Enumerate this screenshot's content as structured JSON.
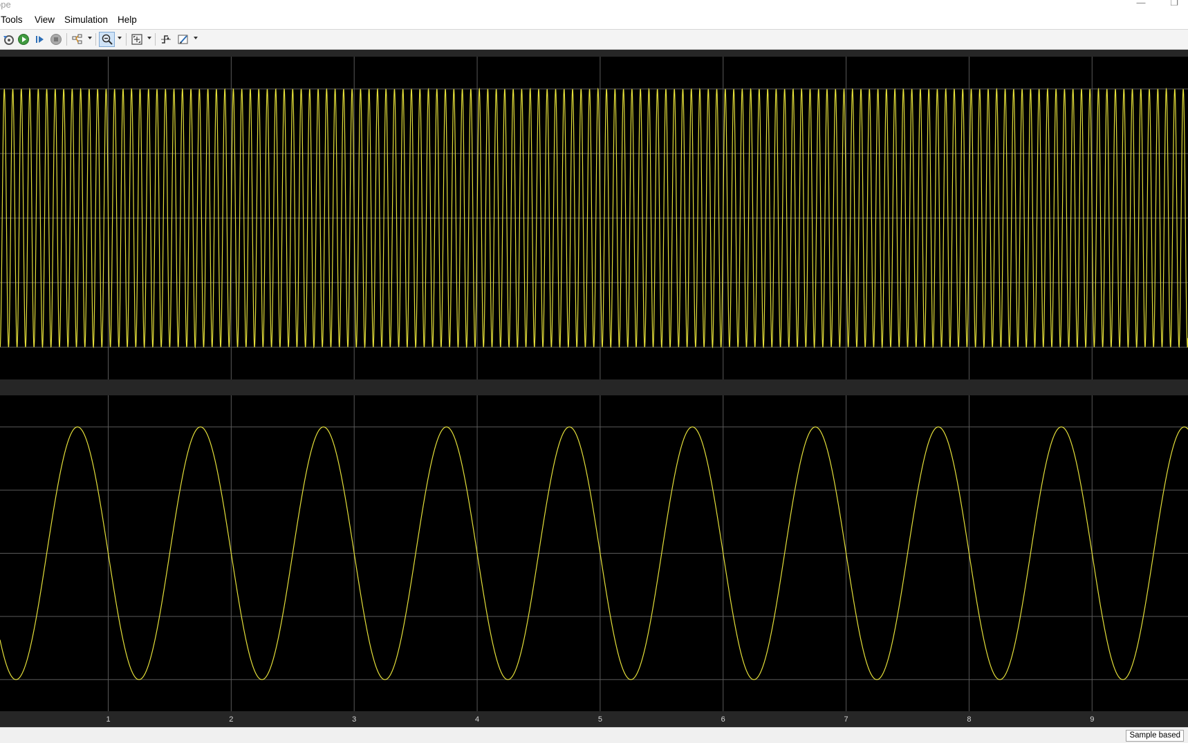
{
  "window": {
    "title": "ope",
    "restore_glyph": "❐",
    "minimize_glyph": "—"
  },
  "menu": [
    "Tools",
    "View",
    "Simulation",
    "Help"
  ],
  "toolbar": {
    "icons": [
      "settings-restore-icon",
      "run-icon",
      "step-forward-icon",
      "stop-icon",
      "highlight-icon",
      "zoom-in-icon",
      "fit-to-view-icon",
      "triggers-icon",
      "cursor-measurements-icon"
    ]
  },
  "colors": {
    "trace": "#e5e03a",
    "plot_bg": "#000000",
    "frame": "#262626",
    "grid": "#5a5a5a"
  },
  "scope": {
    "x_ticks": [
      "1",
      "2",
      "3",
      "4",
      "5",
      "6",
      "7",
      "8",
      "9"
    ]
  },
  "chart_data": [
    {
      "type": "line",
      "xlim": [
        0.12,
        9.78
      ],
      "ylim": [
        -1.25,
        1.25
      ],
      "x_ticks": [
        1,
        2,
        3,
        4,
        5,
        6,
        7,
        8,
        9
      ],
      "y_gridlines": [
        -1,
        -0.5,
        0,
        0.5,
        1
      ],
      "grid": true,
      "series": [
        {
          "frequency_hz": 14.5,
          "amplitude": 1,
          "color": "#e5e03a"
        }
      ]
    },
    {
      "type": "line",
      "xlim": [
        0.12,
        9.78
      ],
      "ylim": [
        -1.25,
        1.25
      ],
      "x_ticks": [
        1,
        2,
        3,
        4,
        5,
        6,
        7,
        8,
        9
      ],
      "y_gridlines": [
        -1,
        -0.5,
        0,
        0.5,
        1
      ],
      "grid": true,
      "series": [
        {
          "frequency_hz": 1,
          "amplitude": 1,
          "phase_deg": 180,
          "color": "#e5e03a"
        }
      ]
    }
  ],
  "status": {
    "mode": "Sample based"
  }
}
